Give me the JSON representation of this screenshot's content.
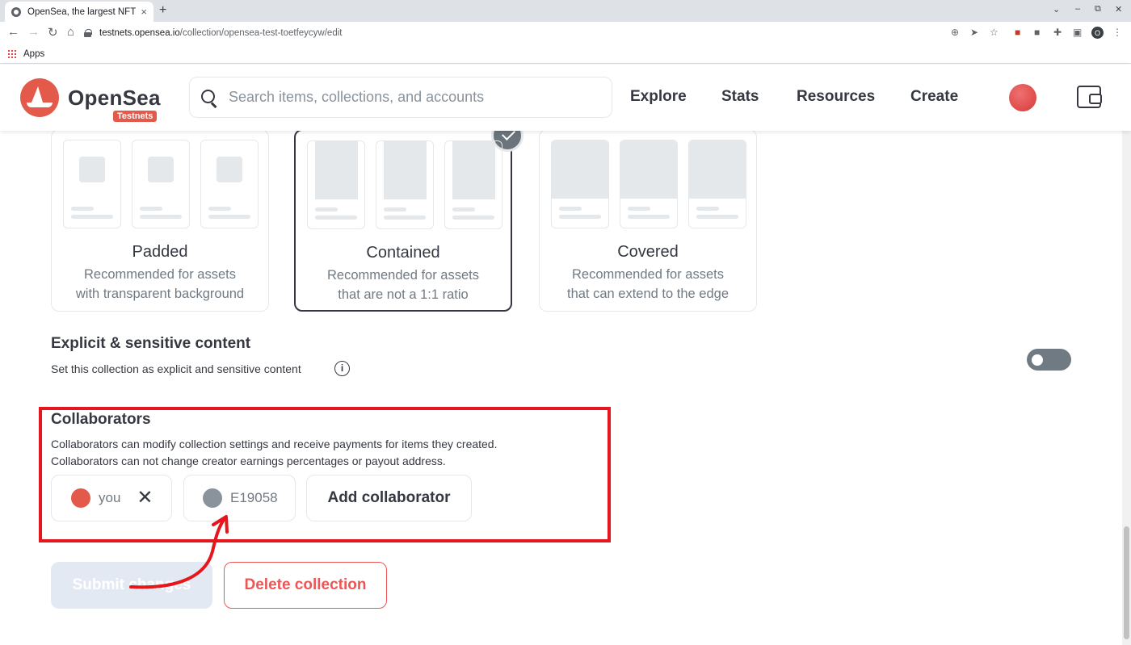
{
  "browser": {
    "tab_title": "OpenSea, the largest NFT",
    "tab_close": "×",
    "new_tab": "+",
    "url_host": "testnets.opensea.io",
    "url_path": "/collection/opensea-test-toetfeycyw/edit",
    "bookmark_apps": "Apps",
    "profile_initial": "O",
    "window_controls": [
      "⌄",
      "–",
      "⧉",
      "✕"
    ]
  },
  "header": {
    "brand": "OpenSea",
    "badge": "Testnets",
    "search_placeholder": "Search items, collections, and accounts",
    "nav": [
      "Explore",
      "Stats",
      "Resources",
      "Create"
    ]
  },
  "display": {
    "cards": [
      {
        "title": "Padded",
        "desc_line1": "Recommended for assets",
        "desc_line2": "with transparent background",
        "selected": false
      },
      {
        "title": "Contained",
        "desc_line1": "Recommended for assets",
        "desc_line2": "that are not a 1:1 ratio",
        "selected": true
      },
      {
        "title": "Covered",
        "desc_line1": "Recommended for assets",
        "desc_line2": "that can extend to the edge",
        "selected": false
      }
    ]
  },
  "explicit": {
    "title": "Explicit & sensitive content",
    "subtitle": "Set this collection as explicit and sensitive content",
    "info_glyph": "i",
    "enabled": false
  },
  "collaborators": {
    "title": "Collaborators",
    "desc_line1": "Collaborators can modify collection settings and receive payments for items they created.",
    "desc_line2": "Collaborators can not change creator earnings percentages or payout address.",
    "chips": [
      {
        "label": "you",
        "color": "#e35a4a",
        "removable": true
      },
      {
        "label": "E19058",
        "color": "#8a939b",
        "removable": false
      }
    ],
    "remove_glyph": "✕",
    "add_label": "Add collaborator"
  },
  "actions": {
    "submit": "Submit changes",
    "delete": "Delete collection"
  },
  "colors": {
    "accent_red": "#e35a4a",
    "annotation_red": "#e5161c",
    "delete_red": "#eb5757",
    "text_dark": "#353840",
    "text_muted": "#707a83"
  }
}
